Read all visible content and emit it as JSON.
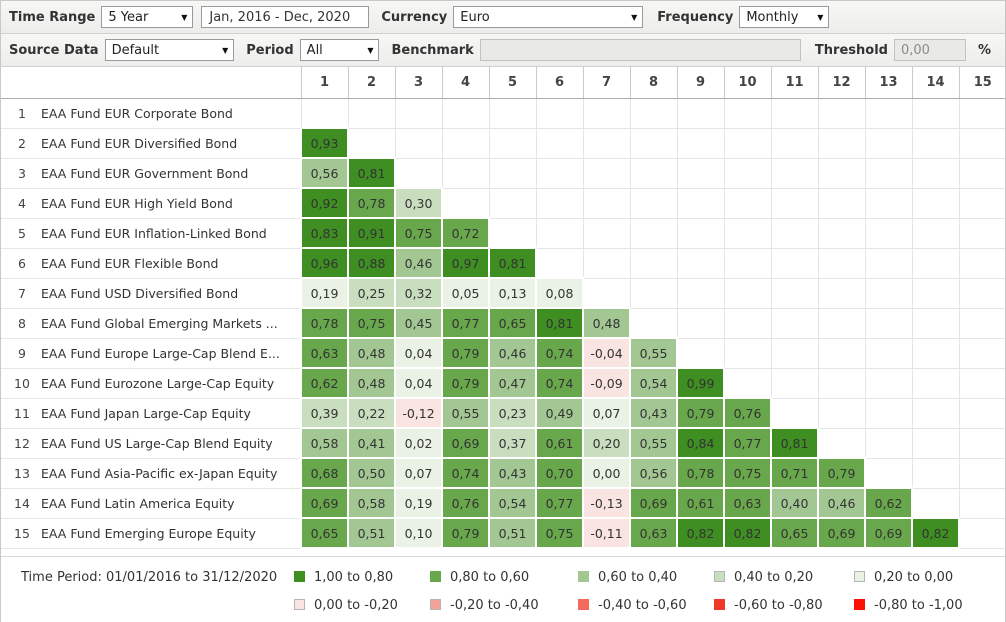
{
  "toolbar1": {
    "time_range_label": "Time Range",
    "time_range_value": "5 Year",
    "date_range": "Jan, 2016 - Dec, 2020",
    "currency_label": "Currency",
    "currency_value": "Euro",
    "frequency_label": "Frequency",
    "frequency_value": "Monthly"
  },
  "toolbar2": {
    "source_data_label": "Source Data",
    "source_data_value": "Default",
    "period_label": "Period",
    "period_value": "All",
    "benchmark_label": "Benchmark",
    "benchmark_value": "",
    "threshold_label": "Threshold",
    "threshold_value": "0,00",
    "percent_label": "%"
  },
  "matrix": {
    "column_headers": [
      "1",
      "2",
      "3",
      "4",
      "5",
      "6",
      "7",
      "8",
      "9",
      "10",
      "11",
      "12",
      "13",
      "14",
      "15"
    ],
    "rows": [
      {
        "num": "1",
        "label": "EAA Fund EUR Corporate Bond",
        "values": []
      },
      {
        "num": "2",
        "label": "EAA Fund EUR Diversified Bond",
        "values": [
          "0,93"
        ]
      },
      {
        "num": "3",
        "label": "EAA Fund EUR Government Bond",
        "values": [
          "0,56",
          "0,81"
        ]
      },
      {
        "num": "4",
        "label": "EAA Fund EUR High Yield Bond",
        "values": [
          "0,92",
          "0,78",
          "0,30"
        ]
      },
      {
        "num": "5",
        "label": "EAA Fund EUR Inflation-Linked Bond",
        "values": [
          "0,83",
          "0,91",
          "0,75",
          "0,72"
        ]
      },
      {
        "num": "6",
        "label": "EAA Fund EUR Flexible Bond",
        "values": [
          "0,96",
          "0,88",
          "0,46",
          "0,97",
          "0,81"
        ]
      },
      {
        "num": "7",
        "label": "EAA Fund USD Diversified Bond",
        "values": [
          "0,19",
          "0,25",
          "0,32",
          "0,05",
          "0,13",
          "0,08"
        ]
      },
      {
        "num": "8",
        "label": "EAA Fund Global Emerging Markets ...",
        "values": [
          "0,78",
          "0,75",
          "0,45",
          "0,77",
          "0,65",
          "0,81",
          "0,48"
        ]
      },
      {
        "num": "9",
        "label": "EAA Fund Europe Large-Cap Blend E...",
        "values": [
          "0,63",
          "0,48",
          "0,04",
          "0,79",
          "0,46",
          "0,74",
          "-0,04",
          "0,55"
        ]
      },
      {
        "num": "10",
        "label": "EAA Fund Eurozone Large-Cap Equity",
        "values": [
          "0,62",
          "0,48",
          "0,04",
          "0,79",
          "0,47",
          "0,74",
          "-0,09",
          "0,54",
          "0,99"
        ]
      },
      {
        "num": "11",
        "label": "EAA Fund Japan Large-Cap Equity",
        "values": [
          "0,39",
          "0,22",
          "-0,12",
          "0,55",
          "0,23",
          "0,49",
          "0,07",
          "0,43",
          "0,79",
          "0,76"
        ]
      },
      {
        "num": "12",
        "label": "EAA Fund US Large-Cap Blend Equity",
        "values": [
          "0,58",
          "0,41",
          "0,02",
          "0,69",
          "0,37",
          "0,61",
          "0,20",
          "0,55",
          "0,84",
          "0,77",
          "0,81"
        ]
      },
      {
        "num": "13",
        "label": "EAA Fund Asia-Pacific ex-Japan Equity",
        "values": [
          "0,68",
          "0,50",
          "0,07",
          "0,74",
          "0,43",
          "0,70",
          "0,00",
          "0,56",
          "0,78",
          "0,75",
          "0,71",
          "0,79"
        ]
      },
      {
        "num": "14",
        "label": "EAA Fund Latin America Equity",
        "values": [
          "0,69",
          "0,58",
          "0,19",
          "0,76",
          "0,54",
          "0,77",
          "-0,13",
          "0,69",
          "0,61",
          "0,63",
          "0,40",
          "0,46",
          "0,62"
        ]
      },
      {
        "num": "15",
        "label": "EAA Fund Emerging Europe Equity",
        "values": [
          "0,65",
          "0,51",
          "0,10",
          "0,79",
          "0,51",
          "0,75",
          "-0,11",
          "0,63",
          "0,82",
          "0,82",
          "0,65",
          "0,69",
          "0,69",
          "0,82"
        ]
      }
    ],
    "color_scale": [
      {
        "min": 0.8,
        "color": "#3e8e22"
      },
      {
        "min": 0.6,
        "color": "#68a74b"
      },
      {
        "min": 0.4,
        "color": "#a3c793"
      },
      {
        "min": 0.2,
        "color": "#c9ddbf"
      },
      {
        "min": 0.0,
        "color": "#eaf2e5"
      },
      {
        "min": -0.2,
        "color": "#fae4e1"
      },
      {
        "min": -0.4,
        "color": "#f2a29a"
      },
      {
        "min": -0.6,
        "color": "#f4695c"
      },
      {
        "min": -0.8,
        "color": "#ef392b"
      },
      {
        "min": -1.0,
        "color": "#fb1105"
      }
    ]
  },
  "legend": {
    "time_period": "Time Period: 01/01/2016 to 31/12/2020",
    "items": [
      {
        "label": "1,00 to 0,80",
        "color": "#3e8e22",
        "border": "#3e8e22"
      },
      {
        "label": "0,80 to 0,60",
        "color": "#68a74b",
        "border": "#68a74b"
      },
      {
        "label": "0,60 to 0,40",
        "color": "#a3c793",
        "border": "#a3c793"
      },
      {
        "label": "0,40 to 0,20",
        "color": "#c9ddbf",
        "border": "#b5b5b5"
      },
      {
        "label": "0,20 to 0,00",
        "color": "#eaf2e5",
        "border": "#b5b5b5"
      },
      {
        "label": "0,00 to -0,20",
        "color": "#fae4e1",
        "border": "#b5b5b5"
      },
      {
        "label": "-0,20 to -0,40",
        "color": "#f2a29a",
        "border": "#b5b5b5"
      },
      {
        "label": "-0,40 to -0,60",
        "color": "#f4695c",
        "border": "#f4695c"
      },
      {
        "label": "-0,60 to -0,80",
        "color": "#ef392b",
        "border": "#ef392b"
      },
      {
        "label": "-0,80 to -1,00",
        "color": "#fb1105",
        "border": "#fb1105"
      }
    ]
  }
}
